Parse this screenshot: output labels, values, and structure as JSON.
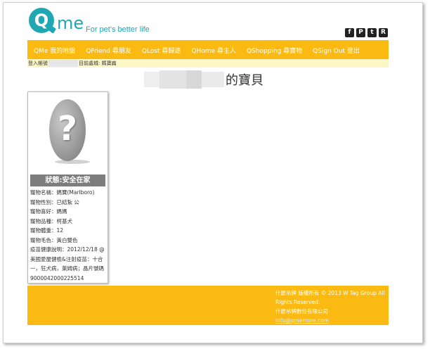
{
  "header": {
    "logo_letter": "Q",
    "logo_text": "me",
    "tagline": "For pet's better life",
    "social": [
      {
        "icon": "facebook-icon",
        "glyph": "f"
      },
      {
        "icon": "pinterest-icon",
        "glyph": "P"
      },
      {
        "icon": "twitter-icon",
        "glyph": "t"
      },
      {
        "icon": "rss-icon",
        "glyph": "R"
      }
    ]
  },
  "nav": {
    "items": [
      {
        "label": "QMe 我的地盤"
      },
      {
        "label": "QFriend 尋朋友"
      },
      {
        "label": "QLost 尋歸途"
      },
      {
        "label": "QHome 尋主人"
      },
      {
        "label": "QShopping 尋寶物"
      },
      {
        "label": "QSign Out 登出"
      }
    ]
  },
  "breadcrumb": {
    "account_label": "登入帳號",
    "location_label": "目前處城: 媽寶扁"
  },
  "page": {
    "title": "的寶貝"
  },
  "pet": {
    "status": "狀態:安全在家",
    "fields": [
      "寵物名稱：媽寶(Marlboro)",
      "寵物性別：已結紮 公",
      "寵物喜好：媽媽",
      "寵物品種：柯基犬",
      "寵物體重：12",
      "寵物毛色：黃白雙色"
    ],
    "health_note": "疫苗健康說明：2012/12/18 @ 美國愛屋健檢&注射疫苗：十合一，狂犬病，萊姆病；晶片號碼 9000042000225514"
  },
  "footer": {
    "line1": "什麼吊牌 版權所有 © 2013 W Tag Group All Rights Reserved.",
    "line2": "什麼吊牌數位有限公司",
    "email": "info@qmemore.com"
  },
  "colors": {
    "brand_teal": "#1fa7b4",
    "nav_yellow": "#fbba12",
    "crumb_bg": "#fdf7c8",
    "status_gray": "#7d7d7d"
  }
}
